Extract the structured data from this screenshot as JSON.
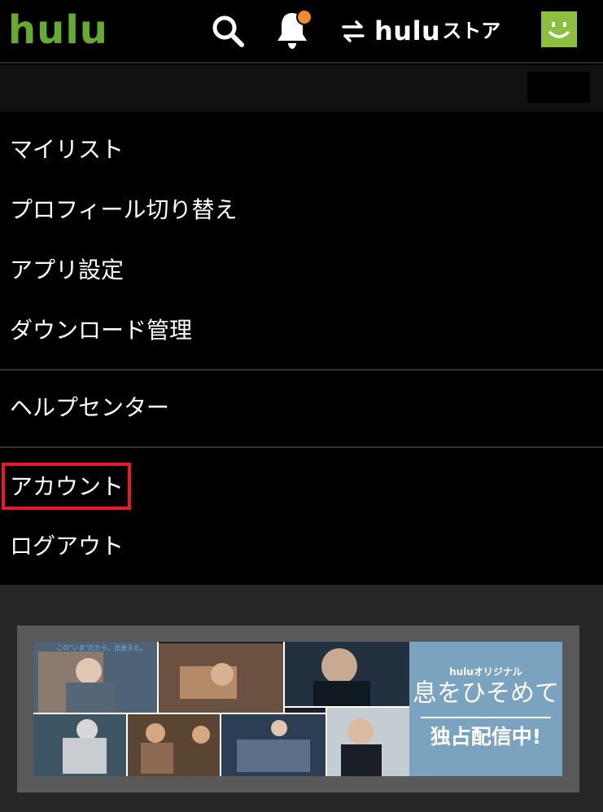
{
  "header": {
    "logo": "hulu",
    "store_word": "hulu",
    "store_kata": "ストア",
    "colors": {
      "brand": "#66aa33",
      "notification": "#f08a2b"
    }
  },
  "menu": {
    "group1": [
      {
        "label": "マイリスト"
      },
      {
        "label": "プロフィール切り替え"
      },
      {
        "label": "アプリ設定"
      },
      {
        "label": "ダウンロード管理"
      }
    ],
    "group2": [
      {
        "label": "ヘルプセンター"
      }
    ],
    "group3": [
      {
        "label": "アカウント"
      },
      {
        "label": "ログアウト"
      }
    ]
  },
  "banner": {
    "tagline": "この\"いま\"だから、出会えた。",
    "brand_small": "huluオリジナル",
    "title": "息をひそめて",
    "subtitle": "独占配信中!"
  }
}
